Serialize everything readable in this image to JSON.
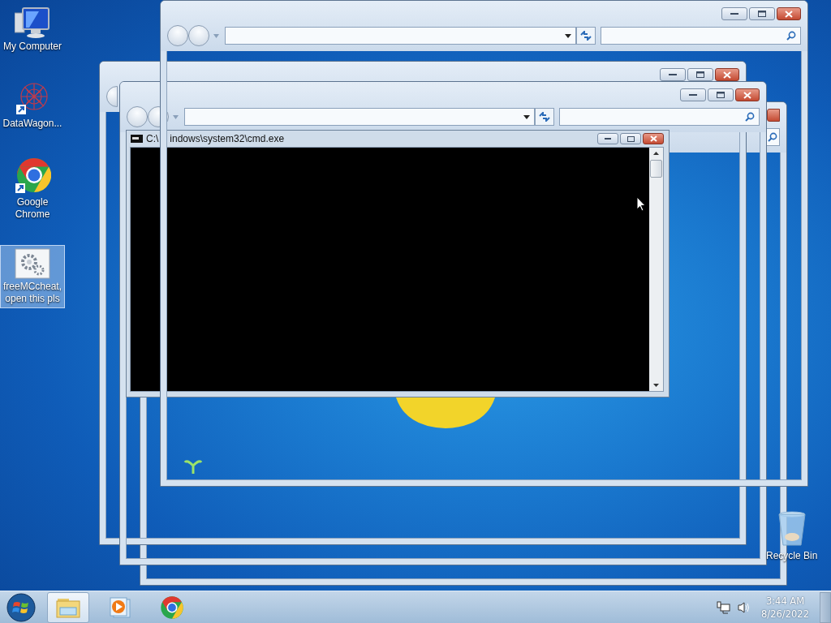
{
  "desktop_icons": [
    {
      "kind": "computer",
      "label": "My Computer",
      "selected": false
    },
    {
      "kind": "graph",
      "label": "DataWagon...",
      "selected": false
    },
    {
      "kind": "chrome",
      "label": "Google Chrome",
      "selected": false
    },
    {
      "kind": "gears",
      "label": "freeMCcheat, open this pls",
      "selected": true
    }
  ],
  "recycle_bin": {
    "label": "Recycle Bin"
  },
  "console_window": {
    "title_parts": [
      "C:\\",
      "indows\\system32\\cmd.exe"
    ]
  },
  "taskbar": {
    "apps": [
      {
        "kind": "explorer",
        "selected": true
      },
      {
        "kind": "media",
        "selected": false
      },
      {
        "kind": "chrome",
        "selected": false
      }
    ],
    "clock": {
      "time": "3:44 AM",
      "date": "8/26/2022"
    }
  }
}
